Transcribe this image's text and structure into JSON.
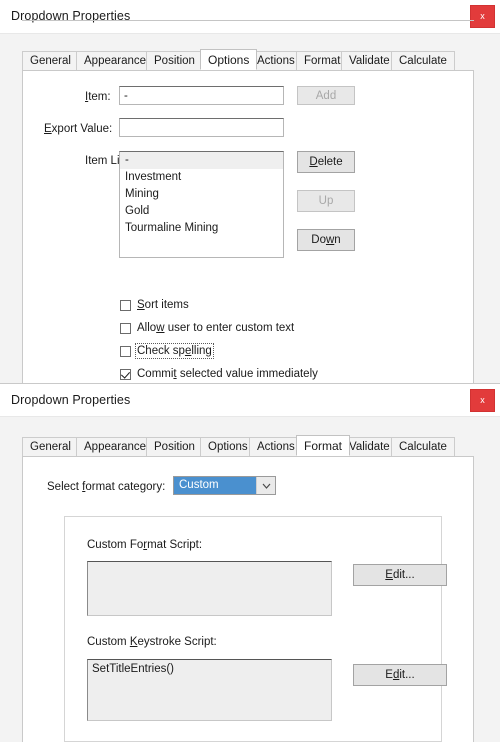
{
  "dialog_options": {
    "title": "Dropdown Properties",
    "close_label": "x",
    "tabs": [
      {
        "label": "General",
        "active": false
      },
      {
        "label": "Appearance",
        "active": false
      },
      {
        "label": "Position",
        "active": false
      },
      {
        "label": "Options",
        "active": true
      },
      {
        "label": "Actions",
        "active": false
      },
      {
        "label": "Format",
        "active": false
      },
      {
        "label": "Validate",
        "active": false
      },
      {
        "label": "Calculate",
        "active": false
      }
    ],
    "item_label_pre": "",
    "item_label_key": "I",
    "item_label_post": "tem:",
    "item_value": "-",
    "add_button": "Add",
    "export_label_key": "E",
    "export_label_post": "xport Value:",
    "export_value": "",
    "item_list_label": "Item List:",
    "item_list": [
      {
        "text": "-",
        "selected": true
      },
      {
        "text": "Investment",
        "selected": false
      },
      {
        "text": "Mining",
        "selected": false
      },
      {
        "text": "Gold",
        "selected": false
      },
      {
        "text": "Tourmaline Mining",
        "selected": false
      }
    ],
    "delete_button_key": "D",
    "delete_button_pre": "",
    "delete_button_post": "elete",
    "up_button": "Up",
    "down_button_pre": "Do",
    "down_button_key": "w",
    "down_button_post": "n",
    "checkboxes": [
      {
        "pre": "",
        "key": "S",
        "post": "ort items",
        "checked": false,
        "focused": false
      },
      {
        "pre": "Allo",
        "key": "w",
        "post": " user to enter custom text",
        "checked": false,
        "focused": false
      },
      {
        "pre": "Check sp",
        "key": "e",
        "post": "lling",
        "checked": false,
        "focused": true
      },
      {
        "pre": "Commi",
        "key": "t",
        "post": " selected value immediately",
        "checked": true,
        "focused": false
      }
    ]
  },
  "dialog_format": {
    "title": "Dropdown Properties",
    "close_label": "x",
    "tabs": [
      {
        "label": "General",
        "active": false
      },
      {
        "label": "Appearance",
        "active": false
      },
      {
        "label": "Position",
        "active": false
      },
      {
        "label": "Options",
        "active": false
      },
      {
        "label": "Actions",
        "active": false
      },
      {
        "label": "Format",
        "active": true
      },
      {
        "label": "Validate",
        "active": false
      },
      {
        "label": "Calculate",
        "active": false
      }
    ],
    "category_label_pre": "Select ",
    "category_label_key": "f",
    "category_label_post": "ormat category:",
    "category_value": "Custom",
    "category_options": [
      "Custom"
    ],
    "format_script_label_pre": "Custom Fo",
    "format_script_label_key": "r",
    "format_script_label_post": "mat Script:",
    "format_script_value": "",
    "format_edit_button_pre": "",
    "format_edit_button_key": "E",
    "format_edit_button_post": "dit...",
    "keystroke_script_label_pre": "Custom ",
    "keystroke_script_label_key": "K",
    "keystroke_script_label_post": "eystroke Script:",
    "keystroke_script_value": "SetTitleEntries()",
    "keystroke_edit_button_pre": "E",
    "keystroke_edit_button_key": "d",
    "keystroke_edit_button_post": "it..."
  },
  "colors": {
    "close_red": "#e23b3b",
    "combo_highlight": "#4a90cf",
    "panel_bg": "#ffffff",
    "dialog_bg": "#f3f3f3"
  }
}
